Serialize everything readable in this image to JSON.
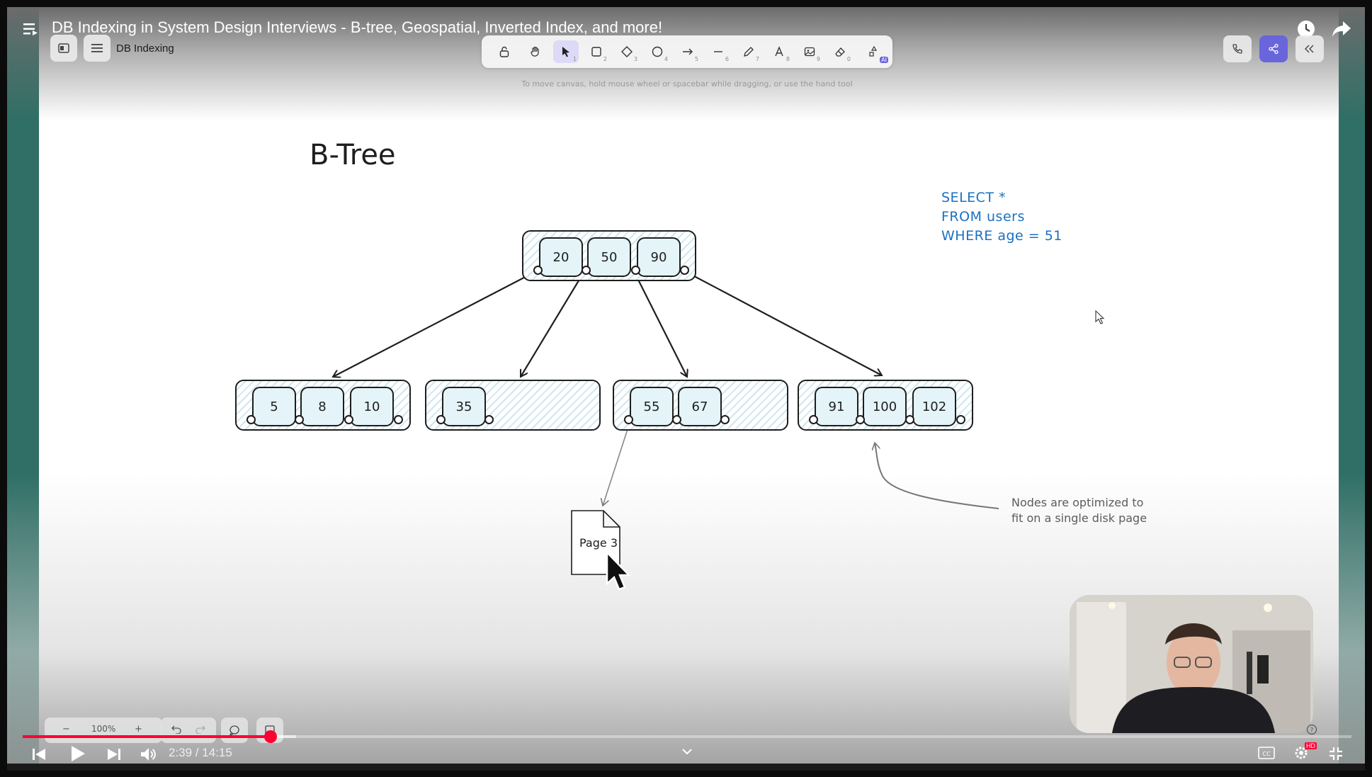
{
  "video": {
    "title": "DB Indexing in System Design Interviews - B-tree, Geospatial, Inverted Index, and more!",
    "time": "2:39 / 14:15",
    "progress_fraction": 0.186,
    "hd_badge": "HD"
  },
  "app": {
    "doc_name": "DB Indexing",
    "hint": "To move canvas, hold mouse wheel or spacebar while dragging, or use the hand tool",
    "ai_badge": "AI",
    "zoom": "100%",
    "tools": [
      {
        "icon": "lock-icon",
        "num": ""
      },
      {
        "icon": "hand-icon",
        "num": ""
      },
      {
        "icon": "pointer-icon",
        "num": "1"
      },
      {
        "icon": "rectangle-icon",
        "num": "2"
      },
      {
        "icon": "diamond-icon",
        "num": "3"
      },
      {
        "icon": "ellipse-icon",
        "num": "4"
      },
      {
        "icon": "arrow-icon",
        "num": "5"
      },
      {
        "icon": "line-icon",
        "num": "6"
      },
      {
        "icon": "pencil-icon",
        "num": "7"
      },
      {
        "icon": "text-icon",
        "num": "8"
      },
      {
        "icon": "image-icon",
        "num": "9"
      },
      {
        "icon": "eraser-icon",
        "num": "0"
      }
    ]
  },
  "diagram": {
    "title": "B-Tree",
    "sql": [
      "SELECT *",
      "FROM users",
      "WHERE age = 51"
    ],
    "note": [
      "Nodes are optimized to",
      "fit on a single disk page"
    ],
    "page_label": "Page 3",
    "root_keys": [
      "20",
      "50",
      "90"
    ],
    "leaves": [
      [
        "5",
        "8",
        "10"
      ],
      [
        "35"
      ],
      [
        "55",
        "67"
      ],
      [
        "91",
        "100",
        "102"
      ]
    ]
  }
}
